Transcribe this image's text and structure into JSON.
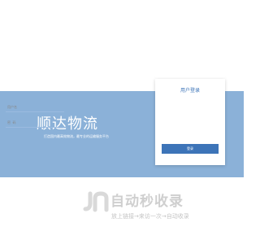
{
  "brand": {
    "title": "顺达物流",
    "subtitle": "打造国内最高效物流，最专业的运输服务平台"
  },
  "login": {
    "title": "用户登录",
    "username_placeholder": "用户名",
    "password_placeholder": "密  码",
    "submit_label": "登录"
  },
  "watermark": {
    "name": "自动秒收录",
    "slogan": "放上链接→来访一次→自动收录",
    "logo_color": "#d9d9d9"
  },
  "colors": {
    "banner": "#8bb1d8",
    "accent": "#3d74b8",
    "field_line": "#9bbbe0"
  }
}
